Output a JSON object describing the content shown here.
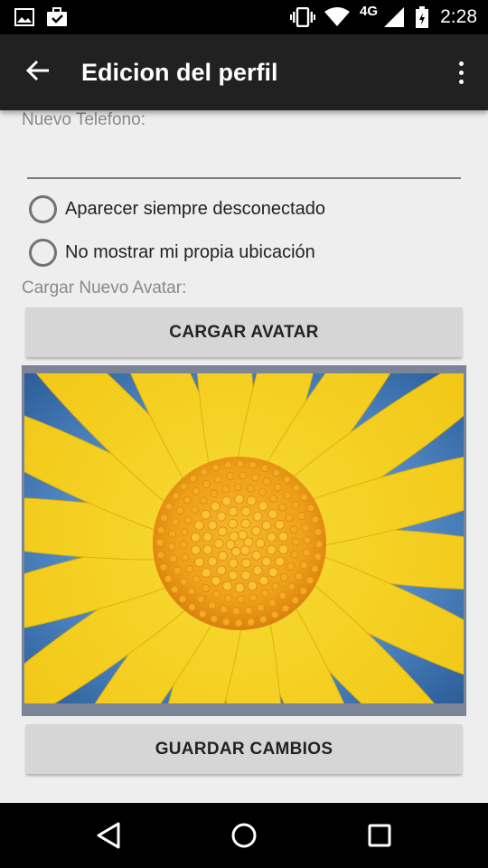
{
  "status_bar": {
    "time": "2:28",
    "network": "4G",
    "icons": [
      "image-notification-icon",
      "download-notification-icon",
      "vibrate-icon",
      "wifi-icon",
      "signal-icon",
      "battery-icon"
    ]
  },
  "app_bar": {
    "title": "Edicion del perfil",
    "back_icon": "arrow-back-icon",
    "menu_icon": "more-vert-icon"
  },
  "form": {
    "phone_label": "Nuevo Telefono:",
    "phone_value": "",
    "options": [
      {
        "label": "Aparecer siempre desconectado",
        "checked": false
      },
      {
        "label": "No mostrar mi propia ubicación",
        "checked": false
      }
    ],
    "avatar_label": "Cargar Nuevo Avatar:",
    "upload_button": "CARGAR AVATAR",
    "avatar_image": "yellow-flower-photo",
    "save_button": "GUARDAR CAMBIOS"
  },
  "nav_bar": {
    "buttons": [
      "back-triangle-icon",
      "home-circle-icon",
      "recents-square-icon"
    ]
  },
  "colors": {
    "app_bar": "#212121",
    "background": "#eeeeee",
    "button": "#d6d6d6",
    "avatar_frame": "#7b8597",
    "petal": "#f5d21f",
    "flower_center": "#f0a51c",
    "sky": "#4f86c2"
  }
}
